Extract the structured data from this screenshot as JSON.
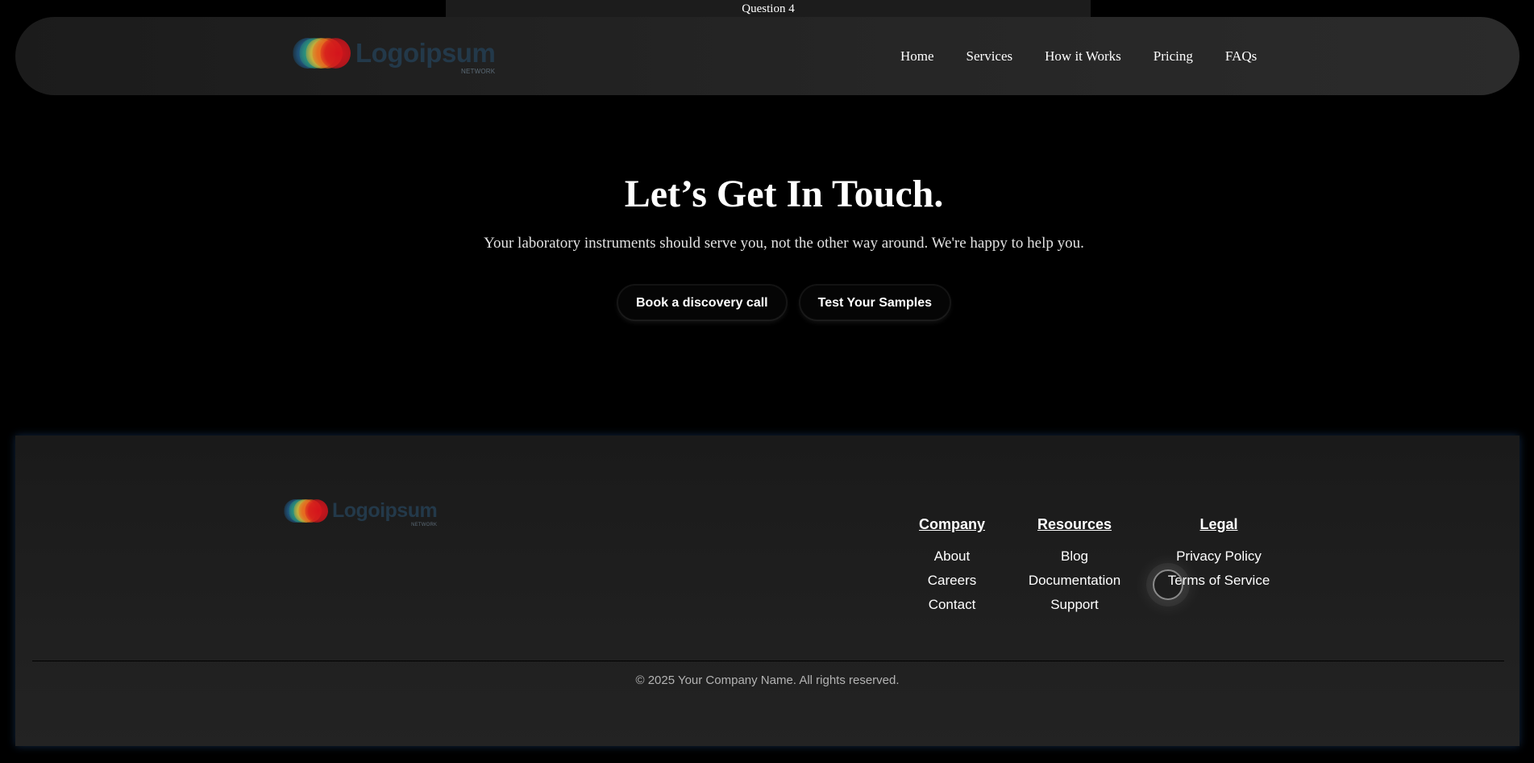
{
  "question_bar": {
    "label": "Question 4"
  },
  "brand": {
    "name": "Logoipsum",
    "tagline": "NETWORK",
    "mark_colors": [
      "#1f5d8c",
      "#2e9c7a",
      "#e8b52c",
      "#e85d1c",
      "#d4141c"
    ]
  },
  "nav": {
    "links": [
      "Home",
      "Services",
      "How it Works",
      "Pricing",
      "FAQs"
    ]
  },
  "hero": {
    "title": "Let’s Get In Touch.",
    "subtitle": "Your laboratory instruments should serve you, not the other way around. We're happy to help you.",
    "primary_cta": "Book a discovery call",
    "secondary_cta": "Test Your Samples"
  },
  "footer": {
    "columns": [
      {
        "title": "Company",
        "links": [
          "About",
          "Careers",
          "Contact"
        ]
      },
      {
        "title": "Resources",
        "links": [
          "Blog",
          "Documentation",
          "Support"
        ]
      },
      {
        "title": "Legal",
        "links": [
          "Privacy Policy",
          "Terms of Service"
        ]
      }
    ],
    "copyright": "© 2025 Your Company Name. All rights reserved."
  }
}
